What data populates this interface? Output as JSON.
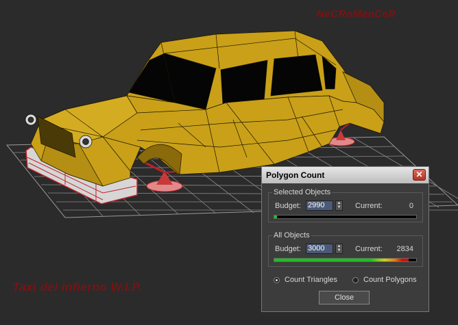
{
  "watermark_top": "NeCRoManCeR",
  "watermark_bottom": "Taxi del infierno W.I.P.",
  "dialog": {
    "title": "Polygon Count",
    "close_glyph": "✕",
    "selected": {
      "legend": "Selected Objects",
      "budget_label": "Budget:",
      "budget_value": "2990",
      "current_label": "Current:",
      "current_value": "0",
      "progress": 0.02
    },
    "all": {
      "legend": "All Objects",
      "budget_label": "Budget:",
      "budget_value": "3000",
      "current_label": "Current:",
      "current_value": "2834",
      "progress": 0.945
    },
    "radio_triangles": "Count Triangles",
    "radio_polygons": "Count Polygons",
    "selected_mode": "triangles",
    "close_button": "Close"
  },
  "colors": {
    "viewport_bg": "#2b2b2b",
    "car_body": "#c9a018",
    "wireframe": "#1a1400",
    "selection_red": "#c0202a",
    "grid": "#8c8c8c",
    "watermark": "#7a1313"
  }
}
